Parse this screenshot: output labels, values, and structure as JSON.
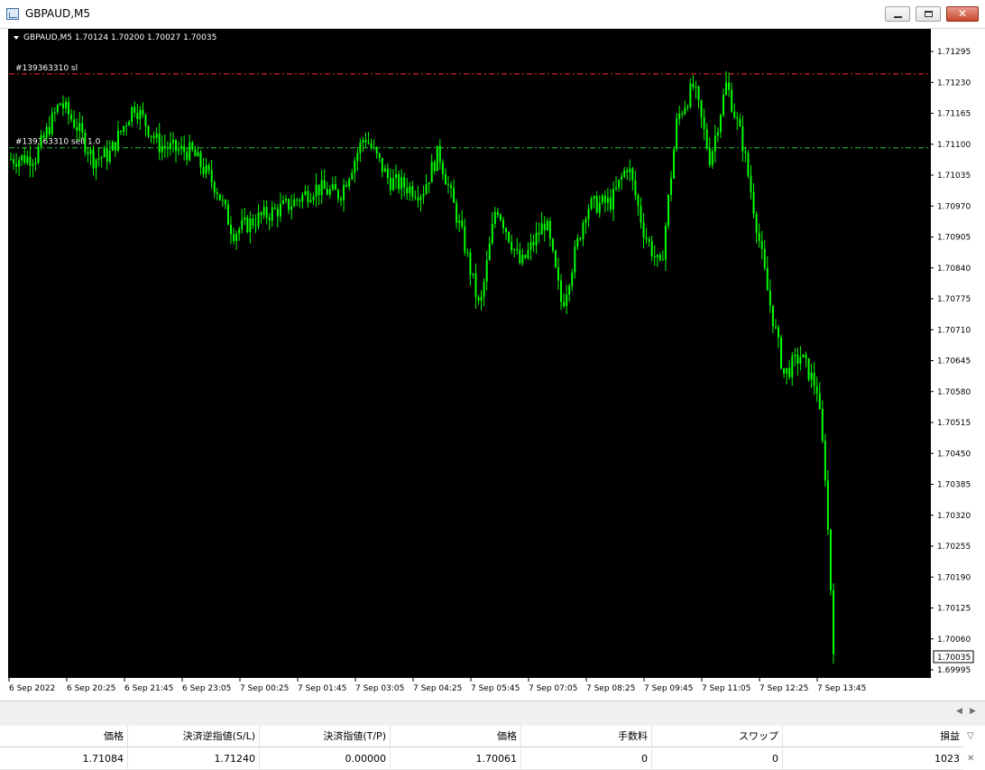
{
  "window": {
    "title": "GBPAUD,M5",
    "icon": "chart-window-icon",
    "controls": {
      "minimize": "minimize-icon",
      "maximize": "maximize-icon",
      "close_label": "✕"
    }
  },
  "chart": {
    "info": "GBPAUD,M5  1.70124 1.70200 1.70027 1.70035",
    "colors": {
      "background": "#000000",
      "candles": "#00ff00",
      "sl_line": "#ff2a2a",
      "order_line": "#30c030",
      "axis_text": "#000000"
    },
    "price_labels": [
      "1.71295",
      "1.71230",
      "1.71165",
      "1.71100",
      "1.71035",
      "1.70970",
      "1.70905",
      "1.70840",
      "1.70775",
      "1.70710",
      "1.70645",
      "1.70580",
      "1.70515",
      "1.70450",
      "1.70385",
      "1.70320",
      "1.70255",
      "1.70190",
      "1.70125",
      "1.70060",
      "1.69995"
    ],
    "time_labels": [
      "6 Sep 2022",
      "6 Sep 20:25",
      "6 Sep 21:45",
      "6 Sep 23:05",
      "7 Sep 00:25",
      "7 Sep 01:45",
      "7 Sep 03:05",
      "7 Sep 04:25",
      "7 Sep 05:45",
      "7 Sep 07:05",
      "7 Sep 08:25",
      "7 Sep 09:45",
      "7 Sep 11:05",
      "7 Sep 12:25",
      "7 Sep 13:45"
    ],
    "current_price": "1.70035",
    "y_range": [
      1.69965,
      1.71335
    ],
    "sl_line": {
      "label": "#139363310 sl",
      "price": 1.7124
    },
    "order_line": {
      "label": "#139363310 sell 1.0",
      "price": 1.71084
    },
    "candle_color_note": "green",
    "price_path": [
      [
        0,
        1.7106
      ],
      [
        0.03,
        1.71065
      ],
      [
        0.06,
        1.7118
      ],
      [
        0.08,
        1.7113
      ],
      [
        0.1,
        1.7106
      ],
      [
        0.12,
        1.7107
      ],
      [
        0.15,
        1.71175
      ],
      [
        0.18,
        1.7109
      ],
      [
        0.2,
        1.7108
      ],
      [
        0.22,
        1.71075
      ],
      [
        0.25,
        1.71
      ],
      [
        0.27,
        1.70905
      ],
      [
        0.3,
        1.70935
      ],
      [
        0.34,
        1.70965
      ],
      [
        0.37,
        1.71
      ],
      [
        0.4,
        1.70985
      ],
      [
        0.43,
        1.7111
      ],
      [
        0.46,
        1.71015
      ],
      [
        0.5,
        1.7099
      ],
      [
        0.52,
        1.71075
      ],
      [
        0.55,
        1.7089
      ],
      [
        0.57,
        1.7074
      ],
      [
        0.59,
        1.70965
      ],
      [
        0.62,
        1.70835
      ],
      [
        0.65,
        1.7093
      ],
      [
        0.67,
        1.7075
      ],
      [
        0.7,
        1.7096
      ],
      [
        0.73,
        1.7097
      ],
      [
        0.75,
        1.7105
      ],
      [
        0.77,
        1.70905
      ],
      [
        0.79,
        1.70825
      ],
      [
        0.81,
        1.71145
      ],
      [
        0.83,
        1.71215
      ],
      [
        0.85,
        1.7106
      ],
      [
        0.87,
        1.7122
      ],
      [
        0.89,
        1.7109
      ],
      [
        0.9,
        1.7099
      ],
      [
        0.92,
        1.7078
      ],
      [
        0.94,
        1.70605
      ],
      [
        0.96,
        1.70645
      ],
      [
        0.98,
        1.70575
      ],
      [
        0.99,
        1.70395
      ],
      [
        1.0,
        1.70035
      ]
    ]
  },
  "trade_table": {
    "headers": [
      "価格",
      "決済逆指値(S/L)",
      "決済指値(T/P)",
      "価格",
      "手数料",
      "スワップ",
      "損益"
    ],
    "row": [
      "1.71084",
      "1.71240",
      "0.00000",
      "1.70061",
      "0",
      "0",
      "1023"
    ],
    "icons": {
      "sort": "sort-arrow-icon",
      "close": "close-position-icon"
    }
  }
}
